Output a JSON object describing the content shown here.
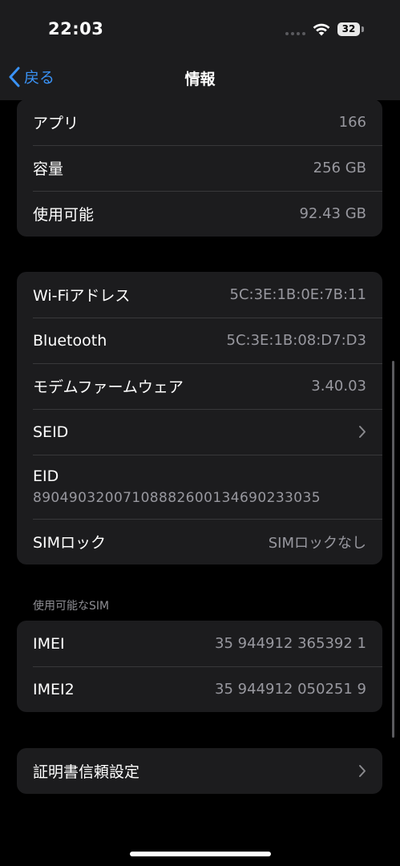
{
  "status_bar": {
    "time": "22:03",
    "battery": "32"
  },
  "nav": {
    "back_label": "戻る",
    "title": "情報"
  },
  "group1": {
    "rows": [
      {
        "label": "アプリ",
        "value": "166"
      },
      {
        "label": "容量",
        "value": "256 GB"
      },
      {
        "label": "使用可能",
        "value": "92.43 GB"
      }
    ]
  },
  "group2": {
    "wifi": {
      "label": "Wi-Fiアドレス",
      "value": "5C:3E:1B:0E:7B:11"
    },
    "bluetooth": {
      "label": "Bluetooth",
      "value": "5C:3E:1B:08:D7:D3"
    },
    "modem": {
      "label": "モデムファームウェア",
      "value": "3.40.03"
    },
    "seid": {
      "label": "SEID"
    },
    "eid": {
      "label": "EID",
      "value": "89049032007108882600134690233035"
    },
    "simlock": {
      "label": "SIMロック",
      "value": "SIMロックなし"
    }
  },
  "sim_section": {
    "header": "使用可能なSIM",
    "rows": [
      {
        "label": "IMEI",
        "value": "35 944912 365392 1"
      },
      {
        "label": "IMEI2",
        "value": "35 944912 050251 9"
      }
    ]
  },
  "group4": {
    "cert_label": "証明書信頼設定"
  },
  "colors": {
    "background": "#000000",
    "cell": "#1c1c1e",
    "accent": "#3a93f7",
    "secondary_text": "#98989f",
    "separator": "#38383a"
  },
  "icons": [
    "wifi-icon",
    "battery-icon",
    "chevron-left-icon",
    "chevron-right-icon"
  ]
}
